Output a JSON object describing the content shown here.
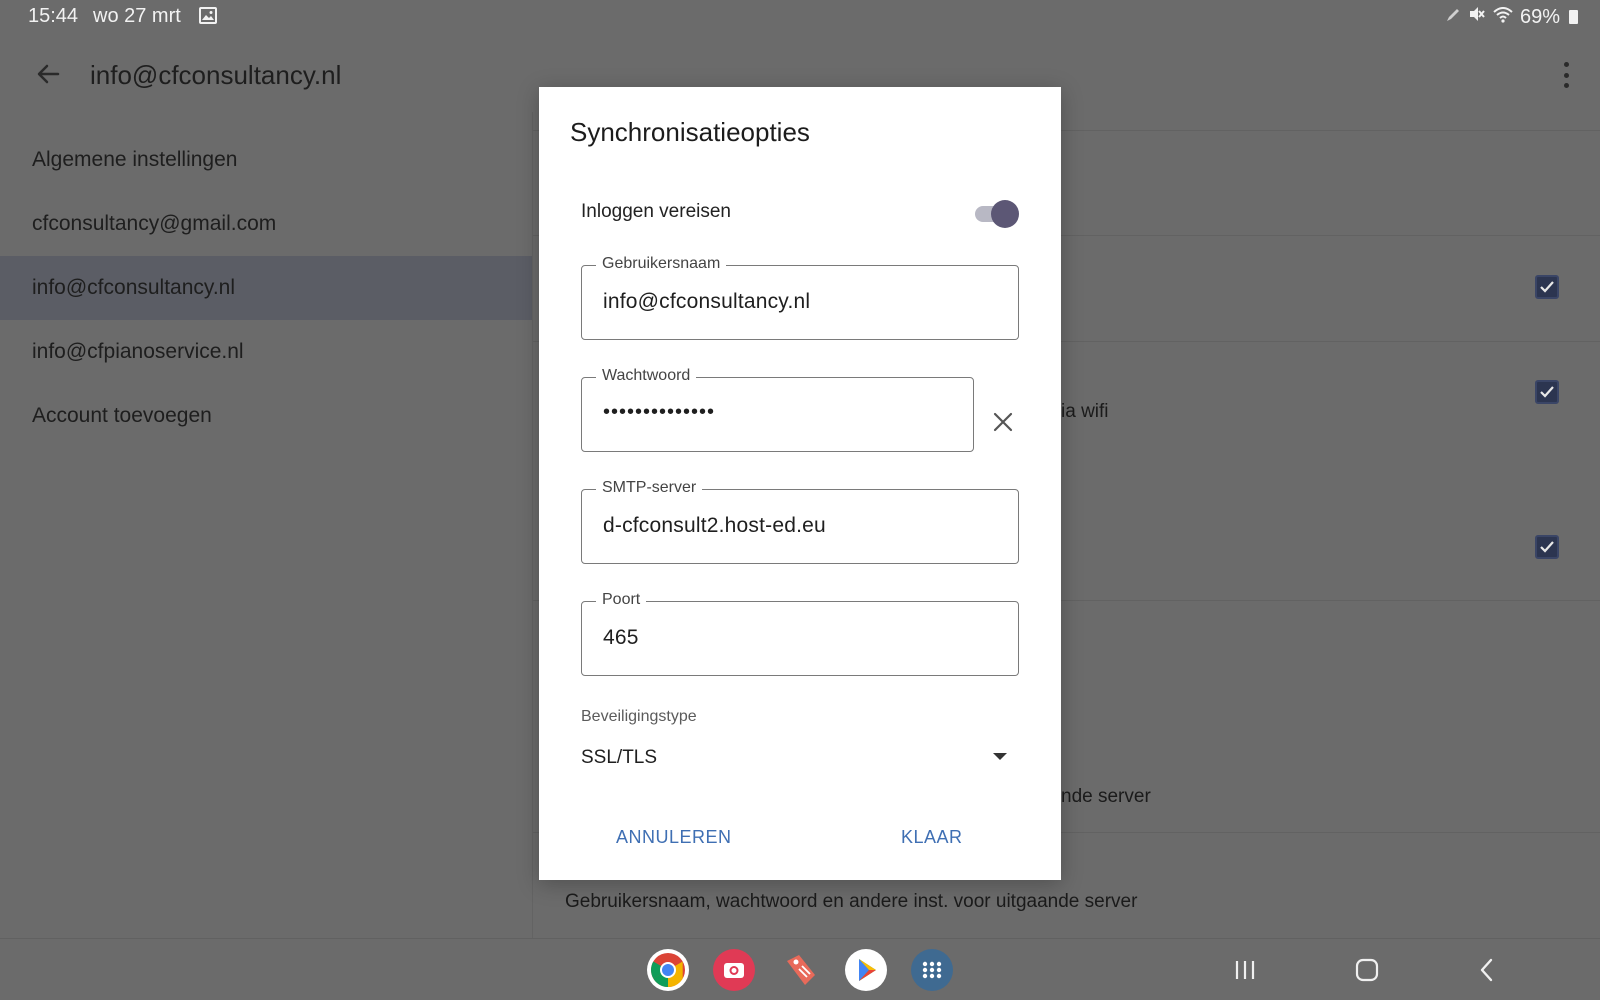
{
  "status_bar": {
    "time": "15:44",
    "date": "wo 27 mrt",
    "battery": "69%",
    "icons": [
      "gallery-icon",
      "pen-icon",
      "mute-icon",
      "wifi-icon",
      "battery-icon"
    ]
  },
  "app_bar": {
    "title": "info@cfconsultancy.nl",
    "back_icon": "arrow-back-icon",
    "menu_icon": "more-vert-icon"
  },
  "accounts": {
    "items": [
      {
        "label": "Algemene instellingen",
        "selected": false
      },
      {
        "label": "cfconsultancy@gmail.com",
        "selected": false
      },
      {
        "label": "info@cfconsultancy.nl",
        "selected": true
      },
      {
        "label": "info@cfpianoservice.nl",
        "selected": false
      },
      {
        "label": "Account toevoegen",
        "selected": false
      }
    ]
  },
  "background_panel": {
    "fragment_wifi": "ia wifi",
    "fragment_server": "nde server",
    "outgoing_description": "Gebruikersnaam, wachtwoord en andere inst. voor uitgaande server",
    "checkboxes": [
      true,
      true,
      true
    ]
  },
  "dialog": {
    "title": "Synchronisatieopties",
    "login_required_label": "Inloggen vereisen",
    "login_required": true,
    "username_label": "Gebruikersnaam",
    "username_value": "info@cfconsultancy.nl",
    "password_label": "Wachtwoord",
    "password_value": "••••••••••••••",
    "smtp_label": "SMTP-server",
    "smtp_value": "d-cfconsult2.host-ed.eu",
    "port_label": "Poort",
    "port_value": "465",
    "security_label": "Beveiligingstype",
    "security_value": "SSL/TLS",
    "cancel_label": "ANNULEREN",
    "done_label": "KLAAR"
  },
  "dock": {
    "apps": [
      "chrome-icon",
      "camera-icon",
      "tag-app-icon",
      "play-store-icon",
      "app-drawer-icon"
    ],
    "nav": [
      "recents-icon",
      "home-icon",
      "back-icon"
    ]
  },
  "colors": {
    "accent": "#3f6fb3",
    "scrim": "#6b6b6b",
    "selected_item": "#5b5d65",
    "toggle_thumb": "#5c5775",
    "checkbox": "#2c3550"
  }
}
